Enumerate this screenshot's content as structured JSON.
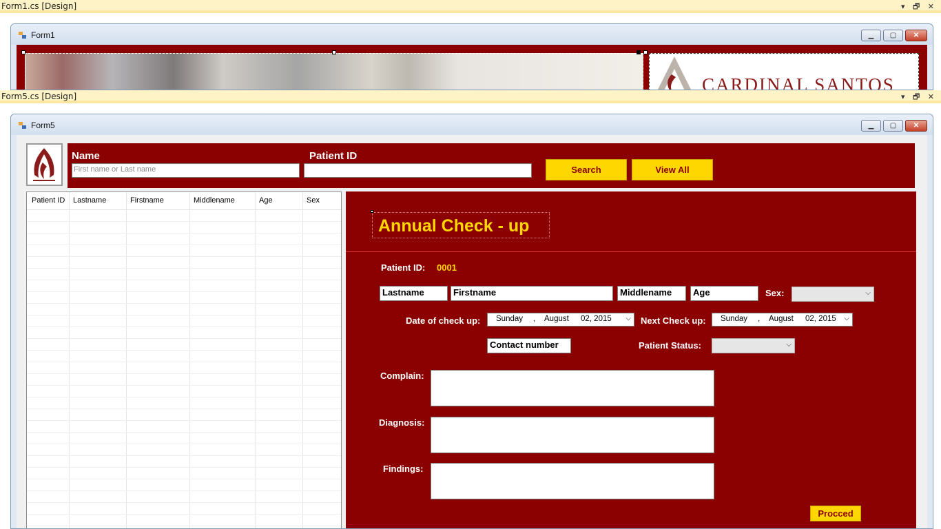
{
  "form1_tab": {
    "title": "Form1.cs [Design]",
    "controls": "▾ 🗗 ✕"
  },
  "form1_window": {
    "title": "Form1",
    "brand_text": "CARDINAL SANTOS"
  },
  "form5_tab": {
    "title": "Form5.cs [Design]",
    "controls": "▾ 🗗 ✕"
  },
  "form5_window": {
    "title": "Form5"
  },
  "window_buttons": {
    "minimize": "▁",
    "maximize": "▢",
    "close": "✕"
  },
  "search_bar": {
    "name_label": "Name",
    "name_placeholder": "First name or Last name",
    "patient_id_label": "Patient ID",
    "patient_id_value": "",
    "search_button": "Search",
    "view_all_button": "View All"
  },
  "grid": {
    "columns": [
      "Patient ID",
      "Lastname",
      "Firstname",
      "Middlename",
      "Age",
      "Sex"
    ]
  },
  "panel": {
    "title": "Annual Check - up",
    "patient_id_label": "Patient ID:",
    "patient_id_value": "0001",
    "lastname": "Lastname",
    "firstname": "Firstname",
    "middlename": "Middlename",
    "age": "Age",
    "sex_label": "Sex:",
    "date_checkup_label": "Date of check up:",
    "date_checkup": {
      "day": "Sunday",
      "sep": ",",
      "month": "August",
      "date": "02, 2015"
    },
    "next_checkup_label": "Next Check up:",
    "next_checkup": {
      "day": "Sunday",
      "sep": ",",
      "month": "August",
      "date": "02, 2015"
    },
    "contact_number": "Contact number",
    "patient_status_label": "Patient Status:",
    "complain_label": "Complain:",
    "diagnosis_label": "Diagnosis:",
    "findings_label": "Findings:",
    "proceed_button": "Procced"
  },
  "colors": {
    "maroon": "#8b0000",
    "gold": "#ffd700"
  },
  "icons": {
    "dropdown": "chevron-down-icon",
    "form": "form-icon",
    "logo": "hospital-logo"
  }
}
